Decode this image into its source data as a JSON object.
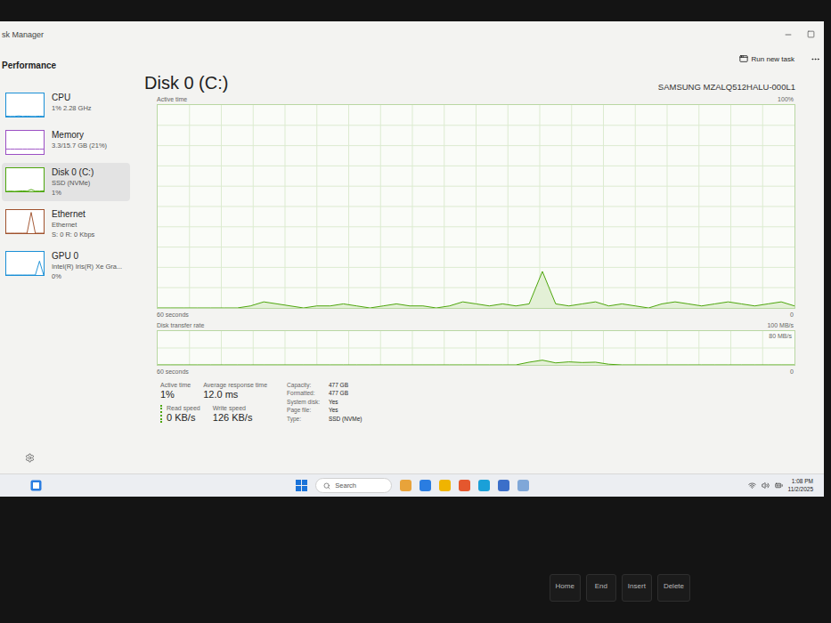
{
  "window": {
    "title": "sk Manager"
  },
  "page": {
    "title": "Performance"
  },
  "toolbar": {
    "run_new_task": "Run new task"
  },
  "sidebar": {
    "items": [
      {
        "name": "CPU",
        "lines": [
          "1% 2.28 GHz"
        ],
        "selected": false,
        "color": "#1a8fd6",
        "series": [
          2,
          1,
          1,
          3,
          1,
          2,
          1,
          1,
          2,
          1
        ]
      },
      {
        "name": "Memory",
        "lines": [
          "3.3/15.7 GB (21%)"
        ],
        "selected": false,
        "color": "#9b4fc4",
        "series": [
          21,
          21,
          21,
          21,
          21,
          21,
          21,
          21,
          21,
          21
        ]
      },
      {
        "name": "Disk 0 (C:)",
        "lines": [
          "SSD (NVMe)",
          "1%"
        ],
        "selected": true,
        "color": "#4da60c",
        "series": [
          0,
          1,
          0,
          1,
          2,
          1,
          8,
          1,
          1,
          2
        ]
      },
      {
        "name": "Ethernet",
        "lines": [
          "Ethernet",
          "S: 0 R: 0 Kbps"
        ],
        "selected": false,
        "color": "#a0522d",
        "series": [
          0,
          0,
          0,
          0,
          0,
          0,
          90,
          0,
          0,
          0
        ]
      },
      {
        "name": "GPU 0",
        "lines": [
          "Intel(R) Iris(R) Xe Gra...",
          "0%"
        ],
        "selected": false,
        "color": "#1a8fd6",
        "series": [
          0,
          0,
          0,
          0,
          0,
          0,
          0,
          0,
          60,
          0
        ]
      }
    ]
  },
  "disk": {
    "title": "Disk 0 (C:)",
    "model": "SAMSUNG MZALQ512HALU-000L1",
    "active_chart": {
      "label": "Active time",
      "max": "100%",
      "time": "60 seconds",
      "min": "0",
      "values": [
        0,
        0,
        0,
        0,
        0,
        0,
        0,
        1,
        3,
        2,
        1,
        0,
        1,
        1,
        2,
        1,
        0,
        1,
        2,
        1,
        1,
        0,
        1,
        3,
        2,
        1,
        2,
        1,
        2,
        18,
        2,
        1,
        2,
        3,
        1,
        2,
        1,
        0,
        2,
        3,
        2,
        1,
        2,
        3,
        2,
        1,
        2,
        3,
        1
      ]
    },
    "transfer_chart": {
      "label": "Disk transfer rate",
      "max": "100 MB/s",
      "mid": "80 MB/s",
      "time": "60 seconds",
      "min": "0",
      "values": [
        0,
        0,
        0,
        0,
        0,
        0,
        0,
        0,
        0,
        0,
        0,
        0,
        0,
        0,
        0,
        0,
        0,
        0,
        0,
        0,
        0,
        0,
        0,
        0,
        0,
        0,
        0,
        0,
        8,
        14,
        6,
        9,
        7,
        8,
        2,
        0,
        0,
        0,
        0,
        0,
        0,
        0,
        0,
        0,
        0,
        0,
        0,
        0,
        0
      ]
    }
  },
  "stats": {
    "primary": [
      {
        "label": "Active time",
        "value": "1%"
      },
      {
        "label": "Average response time",
        "value": "12.0 ms"
      }
    ],
    "secondary": [
      {
        "label": "Read speed",
        "value": "0 KB/s"
      },
      {
        "label": "Write speed",
        "value": "126 KB/s"
      }
    ],
    "details": [
      {
        "label": "Capacity:",
        "value": "477 GB"
      },
      {
        "label": "Formatted:",
        "value": "477 GB"
      },
      {
        "label": "System disk:",
        "value": "Yes"
      },
      {
        "label": "Page file:",
        "value": "Yes"
      },
      {
        "label": "Type:",
        "value": "SSD (NVMe)"
      }
    ]
  },
  "taskbar": {
    "search": "Search",
    "time": "1:08 PM",
    "date": "11/2/2025"
  },
  "keyboard": {
    "keys": [
      "Home",
      "End",
      "Insert",
      "Delete"
    ]
  }
}
